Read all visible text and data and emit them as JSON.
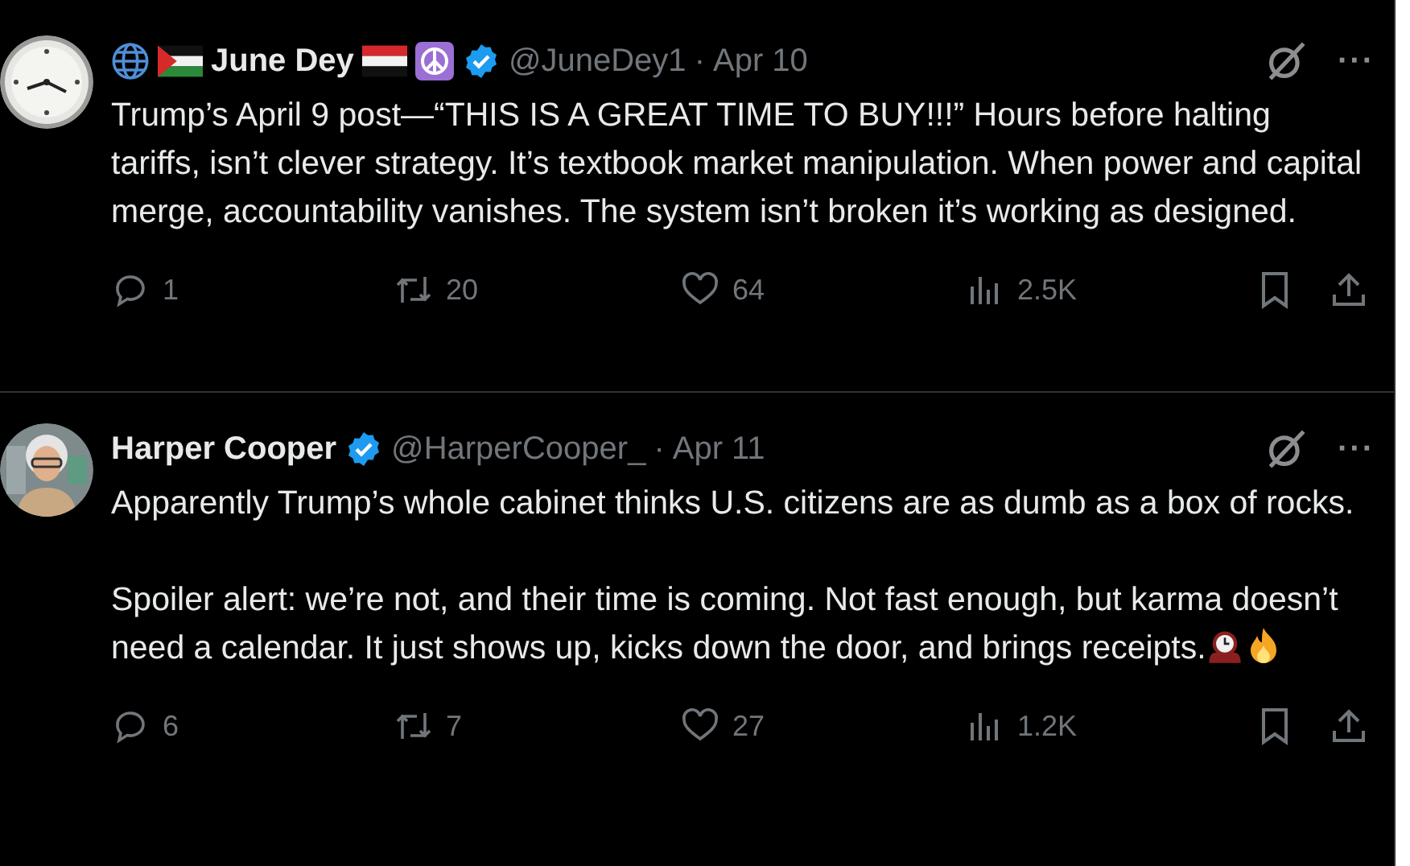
{
  "tweets": [
    {
      "avatar": {
        "kind": "clock"
      },
      "name_prefix_icons": [
        {
          "kind": "globe"
        },
        {
          "kind": "flag-palestine"
        }
      ],
      "name": "June Dey",
      "name_suffix_icons": [
        {
          "kind": "flag-yemen"
        },
        {
          "kind": "peace"
        }
      ],
      "verified": true,
      "handle": "@JuneDey1",
      "separator": "·",
      "date": "Apr 10",
      "menu": "···",
      "paragraphs": [
        {
          "text": "Trump’s April 9 post—“THIS IS A GREAT TIME TO BUY!!!” Hours before halting tariffs, isn’t clever strategy. It’s textbook market manipulation. When power and capital merge, accountability vanishes. The system isn’t broken it’s working as designed."
        }
      ],
      "actions": [
        {
          "kind": "reply",
          "count": "1"
        },
        {
          "kind": "repost",
          "count": "20"
        },
        {
          "kind": "like",
          "count": "64"
        },
        {
          "kind": "views",
          "count": "2.5K"
        },
        {
          "kind": "bookmark"
        },
        {
          "kind": "share"
        }
      ]
    },
    {
      "avatar": {
        "kind": "person"
      },
      "name": "Harper Cooper",
      "verified": true,
      "handle": "@HarperCooper_",
      "separator": "·",
      "date": "Apr 11",
      "menu": "···",
      "paragraphs": [
        {
          "text": "Apparently Trump’s whole cabinet thinks U.S. citizens are as dumb as a box of rocks."
        },
        {
          "text": "Spoiler alert: we’re not, and their time is coming. Not fast enough, but karma doesn’t need a calendar. It just shows up, kicks down the door, and brings receipts.",
          "trailing_icons": [
            {
              "kind": "mantel-clock"
            },
            {
              "kind": "fire"
            }
          ]
        }
      ],
      "actions": [
        {
          "kind": "reply",
          "count": "6"
        },
        {
          "kind": "repost",
          "count": "7"
        },
        {
          "kind": "like",
          "count": "27"
        },
        {
          "kind": "views",
          "count": "1.2K"
        },
        {
          "kind": "bookmark"
        },
        {
          "kind": "share"
        }
      ]
    }
  ]
}
